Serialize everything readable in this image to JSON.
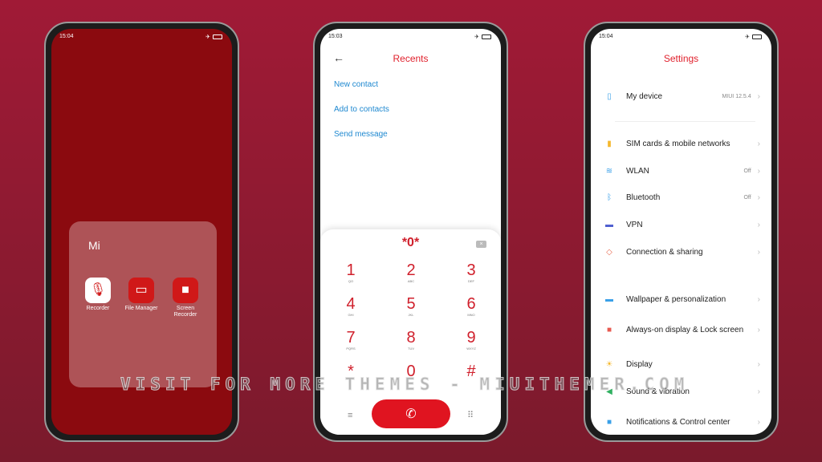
{
  "home": {
    "time": "15:04",
    "folder": "Mi",
    "apps": [
      {
        "label": "Recorder",
        "icon": "microphone-icon"
      },
      {
        "label": "File Manager",
        "icon": "folder-icon"
      },
      {
        "label": "Screen Recorder",
        "icon": "video-camera-icon"
      }
    ]
  },
  "dialer": {
    "time": "15:03",
    "title": "Recents",
    "actions": [
      "New contact",
      "Add to contacts",
      "Send message"
    ],
    "number": "*0*",
    "keys": [
      {
        "d": "1",
        "l": "QO"
      },
      {
        "d": "2",
        "l": "ABC"
      },
      {
        "d": "3",
        "l": "DEF"
      },
      {
        "d": "4",
        "l": "GHI"
      },
      {
        "d": "5",
        "l": "JKL"
      },
      {
        "d": "6",
        "l": "MNO"
      },
      {
        "d": "7",
        "l": "PQRS"
      },
      {
        "d": "8",
        "l": "TUV"
      },
      {
        "d": "9",
        "l": "WXYZ"
      },
      {
        "d": "*",
        "l": ""
      },
      {
        "d": "0",
        "l": ""
      },
      {
        "d": "#",
        "l": ""
      }
    ]
  },
  "settings": {
    "time": "15:04",
    "title": "Settings",
    "items": [
      {
        "label": "My device",
        "value": "MIUI 12.5.4",
        "icon": "phone-icon",
        "color": "#3aa0e8"
      },
      {
        "label": "SIM cards & mobile networks",
        "value": "",
        "icon": "sim-icon",
        "color": "#f5b82e"
      },
      {
        "label": "WLAN",
        "value": "Off",
        "icon": "wifi-icon",
        "color": "#3aa0e8"
      },
      {
        "label": "Bluetooth",
        "value": "Off",
        "icon": "bluetooth-icon",
        "color": "#3aa0e8"
      },
      {
        "label": "VPN",
        "value": "",
        "icon": "vpn-icon",
        "color": "#5060d0"
      },
      {
        "label": "Connection & sharing",
        "value": "",
        "icon": "share-icon",
        "color": "#e86a50"
      },
      {
        "label": "Wallpaper & personalization",
        "value": "",
        "icon": "wallpaper-icon",
        "color": "#3aa0e8"
      },
      {
        "label": "Always-on display & Lock screen",
        "value": "",
        "icon": "lock-icon",
        "color": "#e85a50"
      },
      {
        "label": "Display",
        "value": "",
        "icon": "sun-icon",
        "color": "#f5b82e"
      },
      {
        "label": "Sound & vibration",
        "value": "",
        "icon": "speaker-icon",
        "color": "#30b060"
      },
      {
        "label": "Notifications & Control center",
        "value": "",
        "icon": "notification-icon",
        "color": "#3aa0e8"
      }
    ]
  },
  "watermark": "VISIT FOR MORE THEMES - MIUITHEMER.COM"
}
